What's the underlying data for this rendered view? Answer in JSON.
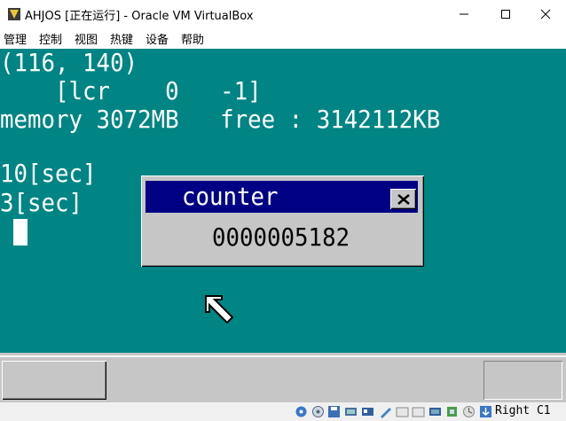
{
  "window": {
    "title": "AHJOS [正在运行] - Oracle VM VirtualBox",
    "minimize_icon": "minimize-icon",
    "maximize_icon": "maximize-icon",
    "close_icon": "close-icon"
  },
  "menu": {
    "items": [
      {
        "label": "管理"
      },
      {
        "label": "控制"
      },
      {
        "label": "视图"
      },
      {
        "label": "热键"
      },
      {
        "label": "设备"
      },
      {
        "label": "帮助"
      }
    ]
  },
  "screen": {
    "background": "#008484",
    "lines": [
      "(116, 140)",
      "    [lcr    0   -1]",
      "memory 3072MB   free : 3142112KB",
      "",
      "10[sec]",
      "3[sec]"
    ]
  },
  "counter_window": {
    "title": "counter",
    "value": "0000005182",
    "title_bg": "#000084"
  },
  "statusbar": {
    "host_key": "Right C1",
    "icons": [
      "hard-disk-icon",
      "optical-drive-icon",
      "floppy-icon",
      "audio-icon",
      "network-icon",
      "usb-icon",
      "shared-folders-icon",
      "display-icon",
      "video-capture-icon",
      "cpu-icon",
      "recording-icon",
      "mouse-integration-icon",
      "keyboard-capture-icon"
    ]
  }
}
